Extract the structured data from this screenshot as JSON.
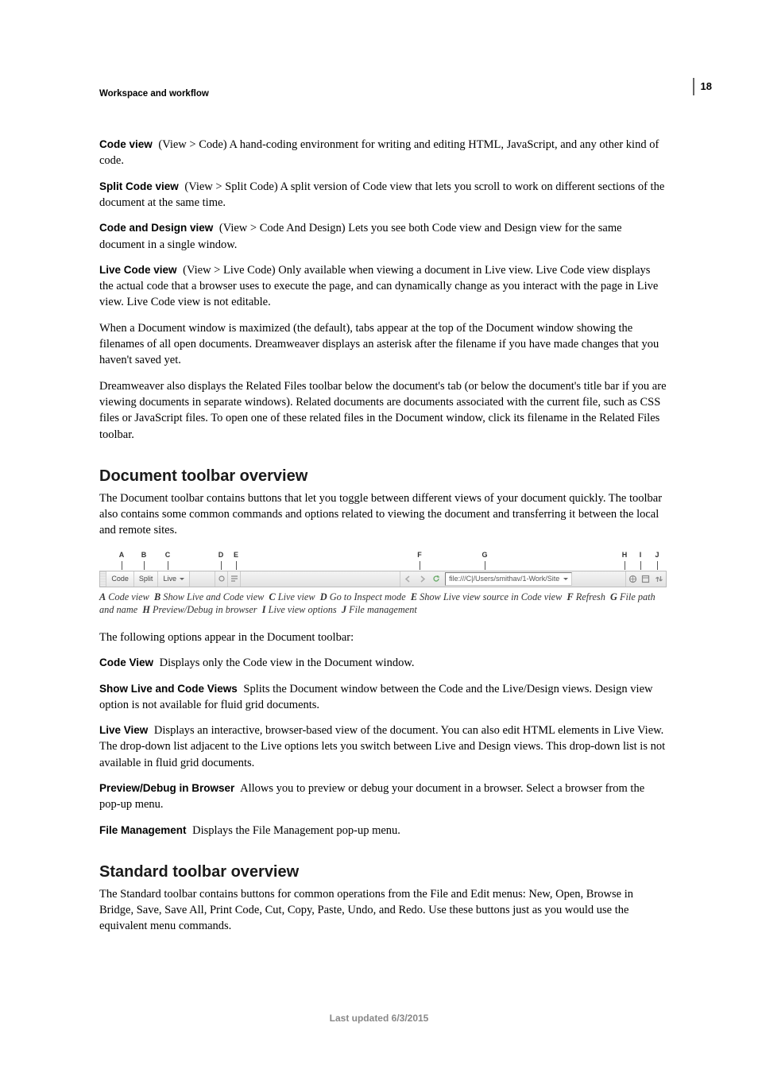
{
  "page_number": "18",
  "running_head": "Workspace and workflow",
  "defs": {
    "code_view": {
      "term": "Code view",
      "body": "(View > Code) A hand-coding environment for writing and editing HTML, JavaScript, and any other kind of code."
    },
    "split_code_view": {
      "term": "Split Code view",
      "body": "(View > Split Code) A split version of Code view that lets you scroll to work on different sections of the document at the same time."
    },
    "code_design_view": {
      "term": "Code and Design view",
      "body": "(View > Code And Design) Lets you see both Code view and Design view for the same document in a single window."
    },
    "live_code_view": {
      "term": "Live Code view",
      "body": "(View > Live Code) Only available when viewing a document in Live view. Live Code view displays the actual code that a browser uses to execute the page, and can dynamically change as you interact with the page in Live view. Live Code view is not editable."
    }
  },
  "para_maximized": "When a Document window is maximized (the default), tabs appear at the top of the Document window showing the filenames of all open documents. Dreamweaver displays an asterisk after the filename if you have made changes that you haven't saved yet.",
  "para_related": "Dreamweaver also displays the Related Files toolbar below the document's tab (or below the document's title bar if you are viewing documents in separate windows). Related documents are documents associated with the current file, such as CSS files or JavaScript files. To open one of these related files in the Document window, click its filename in the Related Files toolbar.",
  "sections": {
    "doc_toolbar": {
      "title": "Document toolbar overview",
      "intro": "The Document toolbar contains buttons that let you toggle between different views of your document quickly. The toolbar also contains some common commands and options related to viewing the document and transferring it between the local and remote sites."
    },
    "std_toolbar": {
      "title": "Standard toolbar overview",
      "body": "The Standard toolbar contains buttons for common operations from the File and Edit menus: New, Open, Browse in Bridge, Save, Save All, Print Code, Cut, Copy, Paste, Undo, and Redo. Use these buttons just as you would use the equivalent menu commands."
    }
  },
  "toolbar": {
    "buttons": {
      "code": "Code",
      "split": "Split",
      "live": "Live"
    },
    "address": "file:///C|/Users/smithav/1-Work/Site"
  },
  "callouts": {
    "A": "A",
    "B": "B",
    "C": "C",
    "D": "D",
    "E": "E",
    "F": "F",
    "G": "G",
    "H": "H",
    "I": "I",
    "J": "J"
  },
  "fig_caption": {
    "A": {
      "k": "A",
      "t": "Code view"
    },
    "B": {
      "k": "B",
      "t": "Show Live and Code view"
    },
    "C": {
      "k": "C",
      "t": "Live view"
    },
    "D": {
      "k": "D",
      "t": "Go to Inspect mode"
    },
    "E": {
      "k": "E",
      "t": "Show Live view source in Code view"
    },
    "F": {
      "k": "F",
      "t": "Refresh"
    },
    "G": {
      "k": "G",
      "t": "File path and name"
    },
    "H": {
      "k": "H",
      "t": "Preview/Debug in browser"
    },
    "I": {
      "k": "I",
      "t": "Live view options"
    },
    "J": {
      "k": "J",
      "t": "File management"
    }
  },
  "following_line": "The following options appear in the Document toolbar:",
  "defs2": {
    "code_view2": {
      "term": "Code View",
      "body": "Displays only the Code view in the Document window."
    },
    "show_live_code": {
      "term": "Show Live and Code Views",
      "body": "Splits the Document window between the Code and the Live/Design views. Design view option is not available for fluid grid documents."
    },
    "live_view": {
      "term": "Live View",
      "body": "Displays an interactive, browser-based view of the document. You can also edit HTML elements in Live View. The drop-down list adjacent to the Live options lets you switch between Live and Design views. This drop-down list is not available in fluid grid documents."
    },
    "preview_debug": {
      "term": "Preview/Debug in Browser",
      "body": "Allows you to preview or debug your document in a browser. Select a browser from the pop-up menu."
    },
    "file_mgmt": {
      "term": "File Management",
      "body": "Displays the File Management pop-up menu."
    }
  },
  "footer": "Last updated 6/3/2015"
}
